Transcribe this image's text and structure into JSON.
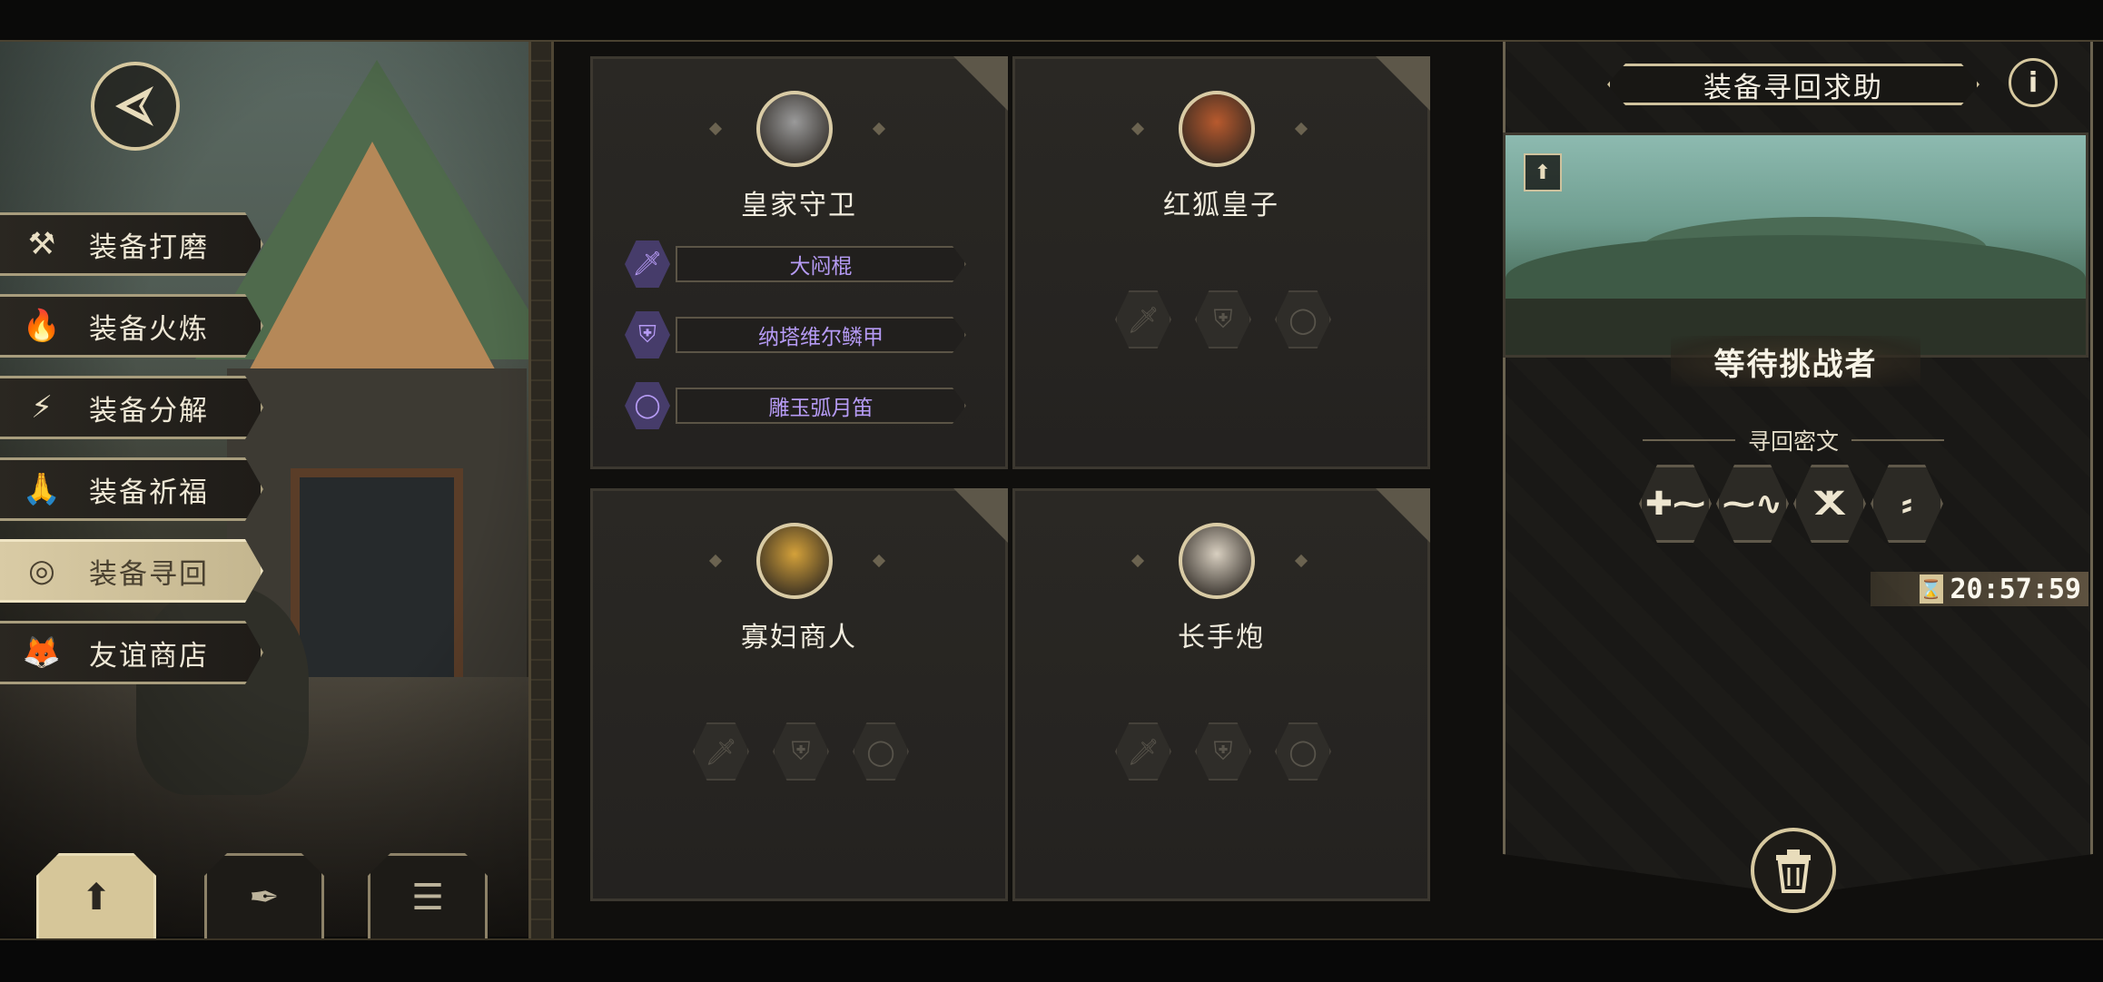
{
  "side_menu": {
    "items": [
      {
        "label": "装备打磨",
        "icon": "hammer-icon",
        "glyph": "⚒",
        "active": false
      },
      {
        "label": "装备火炼",
        "icon": "flame-icon",
        "glyph": "🔥",
        "active": false
      },
      {
        "label": "装备分解",
        "icon": "disassemble-icon",
        "glyph": "⚡",
        "active": false
      },
      {
        "label": "装备祈福",
        "icon": "pray-icon",
        "glyph": "🙏",
        "active": false
      },
      {
        "label": "装备寻回",
        "icon": "target-icon",
        "glyph": "◎",
        "active": true
      },
      {
        "label": "友谊商店",
        "icon": "fox-icon",
        "glyph": "🦊",
        "active": false
      }
    ]
  },
  "bottom_tabs": [
    {
      "icon": "upload-icon",
      "glyph": "⬆",
      "active": true
    },
    {
      "icon": "feather-icon",
      "glyph": "✒",
      "active": false
    },
    {
      "icon": "list-icon",
      "glyph": "☰",
      "active": false
    }
  ],
  "characters": [
    {
      "name": "皇家守卫",
      "portrait_color": "#9a9a9a",
      "equipment": [
        {
          "icon": "sword-icon",
          "glyph": "🗡",
          "name": "大闷棍"
        },
        {
          "icon": "armor-icon",
          "glyph": "⛨",
          "name": "纳塔维尔鳞甲"
        },
        {
          "icon": "ring-icon",
          "glyph": "◯",
          "name": "雕玉弧月笛"
        }
      ]
    },
    {
      "name": "红狐皇子",
      "portrait_color": "#b85a2e",
      "equipment": []
    },
    {
      "name": "寡妇商人",
      "portrait_color": "#d4a13a",
      "equipment": []
    },
    {
      "name": "长手炮",
      "portrait_color": "#d8cfc0",
      "equipment": []
    }
  ],
  "right_panel": {
    "title": "装备寻回求助",
    "info_glyph": "i",
    "status": "等待挑战者",
    "cipher_title": "寻回密文",
    "runes": [
      "✚⁓",
      "⁓∿",
      "ⵅ",
      "⸗"
    ],
    "timer": "20:57:59",
    "hourglass": "⌛",
    "upload_glyph": "⬆"
  },
  "colors": {
    "accent": "#d7c9a0",
    "equipment_purple": "#b69bf5",
    "panel": "#242220"
  }
}
